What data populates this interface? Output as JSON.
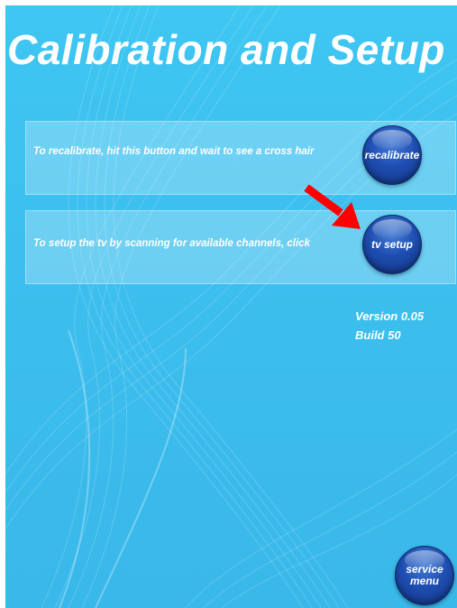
{
  "title": "Calibration and Setup",
  "recalibrate": {
    "instruction": "To recalibrate, hit this button and wait to see a cross hair",
    "button_label": "recalibrate"
  },
  "tv_setup": {
    "instruction": "To setup the tv by scanning for available channels, click",
    "button_label": "tv setup"
  },
  "version": {
    "version_text": "Version 0.05",
    "build_text": "Build 50"
  },
  "service": {
    "line1": "service",
    "line2": "menu"
  },
  "colors": {
    "background": "#3cbfee",
    "button": "#1f4fb3",
    "arrow": "#ff0000",
    "text": "#ffffff"
  },
  "icons": {
    "annotation": "red-arrow-icon"
  }
}
